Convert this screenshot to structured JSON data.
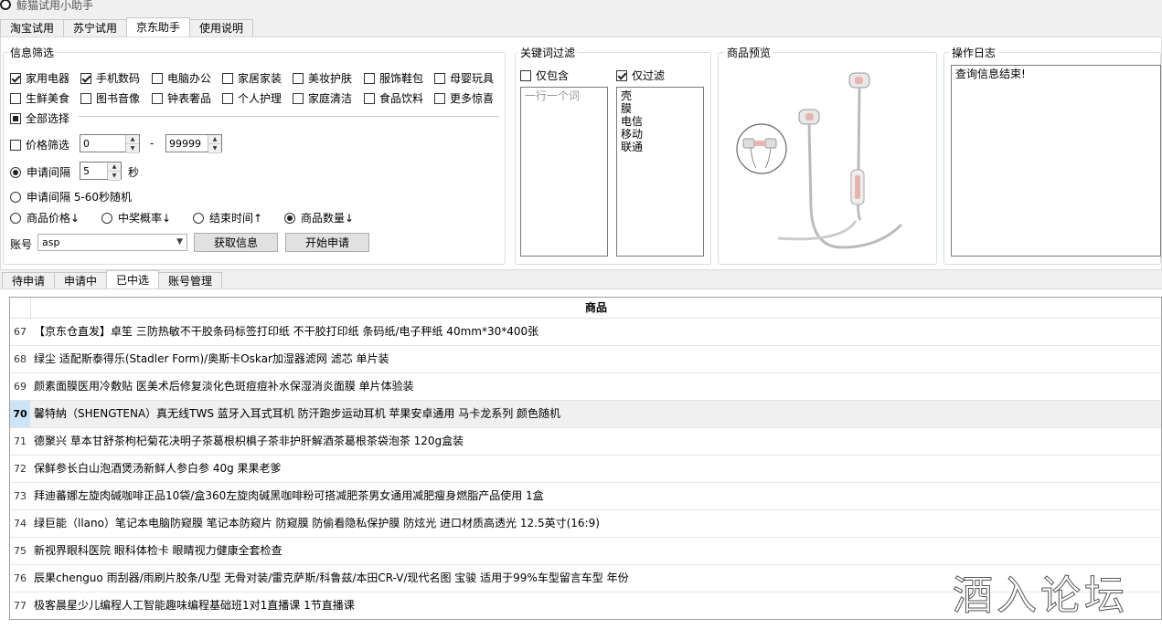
{
  "window": {
    "title": "鲸猫试用小助手"
  },
  "top_tabs": [
    {
      "label": "淘宝试用",
      "active": false
    },
    {
      "label": "苏宁试用",
      "active": false
    },
    {
      "label": "京东助手",
      "active": true
    },
    {
      "label": "使用说明",
      "active": false
    }
  ],
  "filter": {
    "group_label": "信息筛选",
    "categories": [
      {
        "label": "家用电器",
        "checked": true
      },
      {
        "label": "手机数码",
        "checked": true
      },
      {
        "label": "电脑办公",
        "checked": false
      },
      {
        "label": "家居家装",
        "checked": false
      },
      {
        "label": "美妆护肤",
        "checked": false
      },
      {
        "label": "服饰鞋包",
        "checked": false
      },
      {
        "label": "母婴玩具",
        "checked": false
      },
      {
        "label": "生鲜美食",
        "checked": false
      },
      {
        "label": "图书音像",
        "checked": false
      },
      {
        "label": "钟表奢品",
        "checked": false
      },
      {
        "label": "个人护理",
        "checked": false
      },
      {
        "label": "家庭清洁",
        "checked": false
      },
      {
        "label": "食品饮料",
        "checked": false
      },
      {
        "label": "更多惊喜",
        "checked": false
      }
    ],
    "select_all": "全部选择",
    "price_filter": "价格筛选",
    "price_min": "0",
    "price_sep": "-",
    "price_max": "99999",
    "interval_label": "申请间隔",
    "interval_value": "5",
    "interval_unit": "秒",
    "random_label": "申请间隔 5-60秒随机",
    "sort_options": [
      {
        "label": "商品价格↓",
        "selected": false
      },
      {
        "label": "中奖概率↓",
        "selected": false
      },
      {
        "label": "结束时间↑",
        "selected": false
      },
      {
        "label": "商品数量↓",
        "selected": true
      }
    ],
    "account_label": "账号",
    "account_value": "asp",
    "fetch_button": "获取信息",
    "start_button": "开始申请"
  },
  "keyword": {
    "group_label": "关键词过滤",
    "include_label": "仅包含",
    "include_checked": false,
    "exclude_label": "仅过滤",
    "exclude_checked": true,
    "include_placeholder": "一行一个词",
    "exclude_words": [
      "壳",
      "膜",
      "电信",
      "移动",
      "联通"
    ]
  },
  "preview": {
    "group_label": "商品预览"
  },
  "log": {
    "group_label": "操作日志",
    "text": "查询信息结束!"
  },
  "bottom_tabs": [
    {
      "label": "待申请",
      "active": false
    },
    {
      "label": "申请中",
      "active": false
    },
    {
      "label": "已中选",
      "active": true
    },
    {
      "label": "账号管理",
      "active": false
    }
  ],
  "table": {
    "header": "商品",
    "selected_row": "70",
    "rows": [
      {
        "num": "67",
        "name": "【京东仓直发】卓笙 三防热敏不干胶条码标签打印纸 不干胶打印纸 条码纸/电子秤纸 40mm*30*400张"
      },
      {
        "num": "68",
        "name": "绿尘 适配斯泰得乐(Stadler Form)/奥斯卡Oskar加湿器滤网 滤芯 单片装"
      },
      {
        "num": "69",
        "name": "颜素面膜医用冷敷贴 医美术后修复淡化色斑痘痘补水保湿消炎面膜 单片体验装"
      },
      {
        "num": "70",
        "name": "馨特納（SHENGTENA）真无线TWS 蓝牙入耳式耳机 防汗跑步运动耳机 苹果安卓通用 马卡龙系列 颜色随机"
      },
      {
        "num": "71",
        "name": "德聚兴 草本甘舒茶枸杞菊花决明子茶葛根枳椇子茶非护肝解酒茶葛根茶袋泡茶 120g盒装"
      },
      {
        "num": "72",
        "name": "保鲜参长白山泡酒煲汤新鲜人参白参  40g 果果老爹"
      },
      {
        "num": "73",
        "name": "拜迪蕃娜左旋肉碱咖啡正品10袋/盒360左旋肉碱黑咖啡粉可搭减肥茶男女通用减肥瘦身燃脂产品使用 1盒"
      },
      {
        "num": "74",
        "name": "绿巨能（llano）笔记本电脑防窥膜 笔记本防窥片 防窥膜 防偷看隐私保护膜 防炫光 进口材质高透光 12.5英寸(16:9)"
      },
      {
        "num": "75",
        "name": "新视界眼科医院 眼科体检卡 眼睛视力健康全套检查"
      },
      {
        "num": "76",
        "name": "辰果chenguo 雨刮器/雨刷片胶条/U型 无骨对装/雷克萨斯/科鲁兹/本田CR-V/现代名图 宝骏 适用于99%车型留言车型 年份"
      },
      {
        "num": "77",
        "name": "极客晨星少儿编程人工智能趣味编程基础班1对1直播课 1节直播课"
      }
    ]
  },
  "watermark": "酒入论坛",
  "colors": {
    "selected_row_num": "#cce4f7",
    "selected_row": "#f0f0f0",
    "earphone_accent": "#e8b4b0"
  }
}
